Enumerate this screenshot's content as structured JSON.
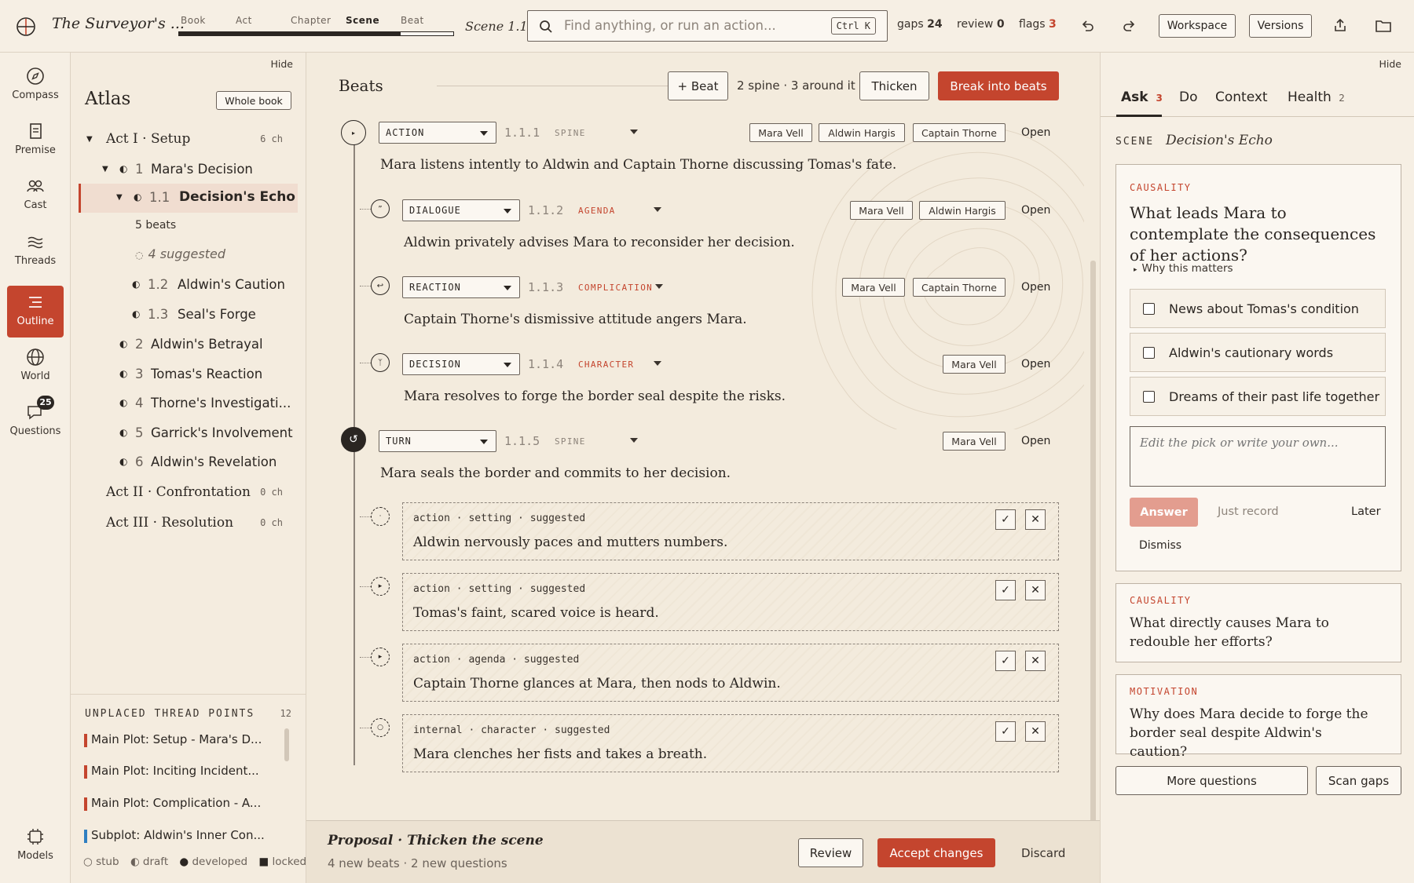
{
  "app": {
    "title": "The Surveyor's ...",
    "scene_label": "Scene 1.1",
    "zoom_levels": [
      "Book",
      "Act",
      "Chapter",
      "Scene",
      "Beat"
    ],
    "active_zoom": "Scene",
    "search_placeholder": "Find anything, or run an action...",
    "search_shortcut": "Ctrl K",
    "stats": {
      "gaps_label": "gaps",
      "gaps": "24",
      "review_label": "review",
      "review": "0",
      "flags_label": "flags",
      "flags": "3"
    },
    "workspace_label": "Workspace",
    "versions_label": "Versions"
  },
  "rail": {
    "items": [
      {
        "label": "Compass",
        "icon": "compass-icon"
      },
      {
        "label": "Premise",
        "icon": "document-icon"
      },
      {
        "label": "Cast",
        "icon": "people-icon"
      },
      {
        "label": "Threads",
        "icon": "threads-icon"
      },
      {
        "label": "Outline",
        "icon": "outline-icon"
      },
      {
        "label": "World",
        "icon": "globe-icon"
      },
      {
        "label": "Questions",
        "icon": "chat-icon",
        "badge": "25"
      }
    ],
    "models_label": "Models",
    "accent": "#c4452e"
  },
  "atlas": {
    "hide_label": "Hide",
    "title": "Atlas",
    "whole_book_label": "Whole book",
    "act1": {
      "label": "Act I · Setup",
      "count": "6 ch"
    },
    "ch1": {
      "num": "1",
      "label": "Mara's Decision"
    },
    "sc11": {
      "num": "1.1",
      "label": "Decision's Echo"
    },
    "beats_count": "5 beats",
    "suggested": "4 suggested",
    "sc12": {
      "num": "1.2",
      "label": "Aldwin's Caution"
    },
    "sc13": {
      "num": "1.3",
      "label": "Seal's Forge"
    },
    "chapters": [
      {
        "num": "2",
        "label": "Aldwin's Betrayal"
      },
      {
        "num": "3",
        "label": "Tomas's Reaction"
      },
      {
        "num": "4",
        "label": "Thorne's Investigati..."
      },
      {
        "num": "5",
        "label": "Garrick's Involvement"
      },
      {
        "num": "6",
        "label": "Aldwin's Revelation"
      }
    ],
    "act2": {
      "label": "Act II · Confrontation",
      "count": "0 ch"
    },
    "act3": {
      "label": "Act III · Resolution",
      "count": "0 ch"
    },
    "unplaced_title": "UNPLACED THREAD POINTS",
    "unplaced_count": "12",
    "unplaced": [
      {
        "label": "Main Plot: Setup - Mara's D...",
        "color": "#c4452e"
      },
      {
        "label": "Main Plot: Inciting Incident...",
        "color": "#c4452e"
      },
      {
        "label": "Main Plot: Complication - A...",
        "color": "#c4452e"
      },
      {
        "label": "Subplot: Aldwin's Inner Con...",
        "color": "#2f7fc1"
      }
    ],
    "legend": {
      "stub": "stub",
      "draft": "draft",
      "developed": "developed",
      "locked": "locked"
    }
  },
  "beats": {
    "title": "Beats",
    "add_label": "+ Beat",
    "summary": "2 spine · 3 around it",
    "thicken_label": "Thicken",
    "break_label": "Break into beats",
    "open_label": "Open",
    "items": [
      {
        "type": "ACTION",
        "num": "1.1.1",
        "role": "SPINE",
        "chips": [
          "Mara Vell",
          "Aldwin Hargis",
          "Captain Thorne"
        ],
        "text": "Mara listens intently to Aldwin and Captain Thorne discussing Tomas's fate."
      },
      {
        "type": "DIALOGUE",
        "num": "1.1.2",
        "role": "AGENDA",
        "chips": [
          "Mara Vell",
          "Aldwin Hargis"
        ],
        "text": "Aldwin privately advises Mara to reconsider her decision."
      },
      {
        "type": "REACTION",
        "num": "1.1.3",
        "role": "COMPLICATION",
        "chips": [
          "Mara Vell",
          "Captain Thorne"
        ],
        "text": "Captain Thorne's dismissive attitude angers Mara."
      },
      {
        "type": "DECISION",
        "num": "1.1.4",
        "role": "CHARACTER",
        "chips": [
          "Mara Vell"
        ],
        "text": "Mara resolves to forge the border seal despite the risks."
      },
      {
        "type": "TURN",
        "num": "1.1.5",
        "role": "SPINE",
        "chips": [
          "Mara Vell"
        ],
        "text": "Mara seals the border and commits to her decision."
      }
    ],
    "suggestions": [
      {
        "meta": "action · setting · suggested",
        "text": "Aldwin nervously paces and mutters numbers."
      },
      {
        "meta": "action · setting · suggested",
        "text": "Tomas's faint, scared voice is heard."
      },
      {
        "meta": "action · agenda · suggested",
        "text": "Captain Thorne glances at Mara, then nods to Aldwin."
      },
      {
        "meta": "internal · character · suggested",
        "text": "Mara clenches her fists and takes a breath."
      }
    ]
  },
  "proposal": {
    "title": "Proposal · Thicken the scene",
    "subtitle": "4 new beats · 2 new questions",
    "review_label": "Review",
    "accept_label": "Accept changes",
    "discard_label": "Discard"
  },
  "panel": {
    "hide_label": "Hide",
    "tabs": [
      {
        "label": "Ask",
        "count": "3"
      },
      {
        "label": "Do",
        "count": ""
      },
      {
        "label": "Context",
        "count": ""
      },
      {
        "label": "Health",
        "count": "2"
      }
    ],
    "scene_label": "SCENE",
    "scene_name": "Decision's Echo",
    "q1": {
      "category": "CAUSALITY",
      "question": "What leads Mara to contemplate the consequences of her actions?",
      "why": "Why this matters",
      "options": [
        "News about Tomas's condition",
        "Aldwin's cautionary words",
        "Dreams of their past life together"
      ],
      "placeholder": "Edit the pick or write your own...",
      "answer_label": "Answer",
      "record_label": "Just record",
      "later_label": "Later",
      "dismiss_label": "Dismiss"
    },
    "q2": {
      "category": "CAUSALITY",
      "question": "What directly causes Mara to redouble her efforts?"
    },
    "q3": {
      "category": "MOTIVATION",
      "question": "Why does Mara decide to forge the border seal despite Aldwin's caution?"
    },
    "more_label": "More questions",
    "scan_label": "Scan gaps"
  }
}
